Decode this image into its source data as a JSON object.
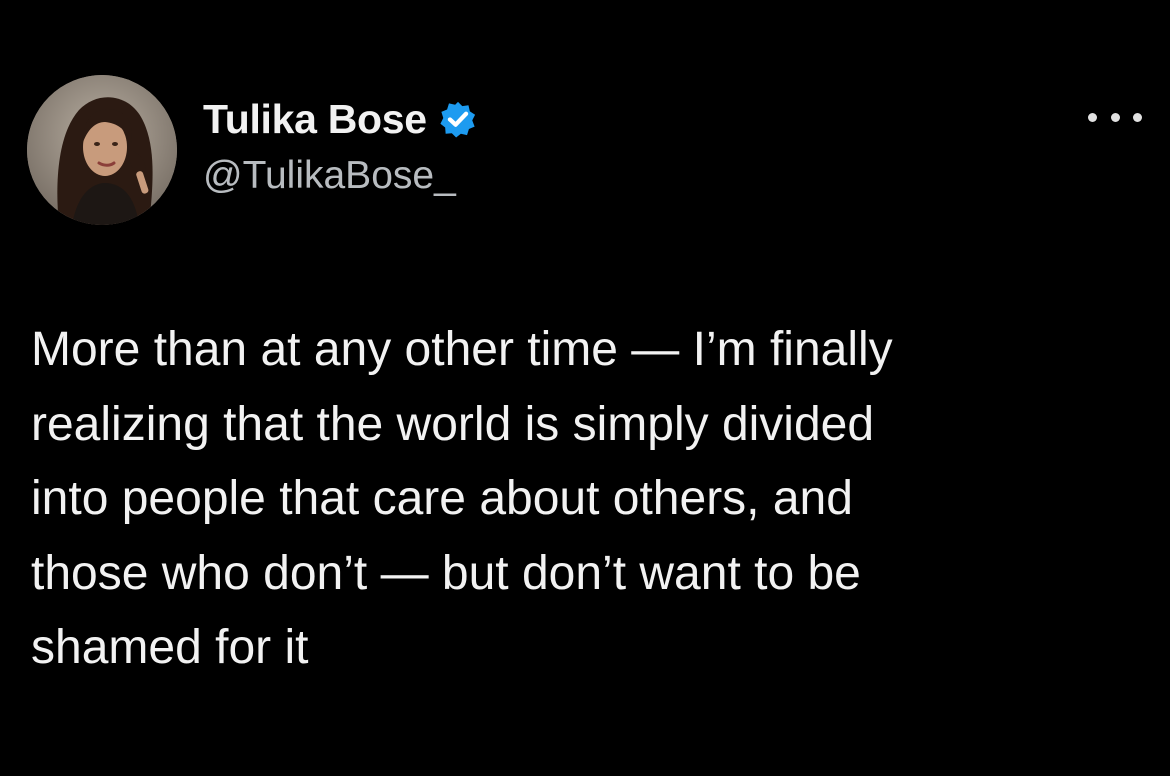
{
  "author": {
    "display_name": "Tulika Bose",
    "handle": "@TulikaBose_",
    "verified_icon": "verified-badge-icon",
    "avatar_icon": "profile-photo"
  },
  "actions": {
    "more_icon": "more-options-icon"
  },
  "tweet": {
    "lines": [
      "More than at any other time — I’m finally",
      "realizing that the world is simply divided",
      "into people that care about others, and",
      "those who don’t — but don’t want to be",
      "shamed for it"
    ]
  },
  "colors": {
    "background": "#000000",
    "text": "#f2f2f2",
    "secondary_text": "#b8bcc0",
    "verified_blue": "#1d9bf0"
  }
}
